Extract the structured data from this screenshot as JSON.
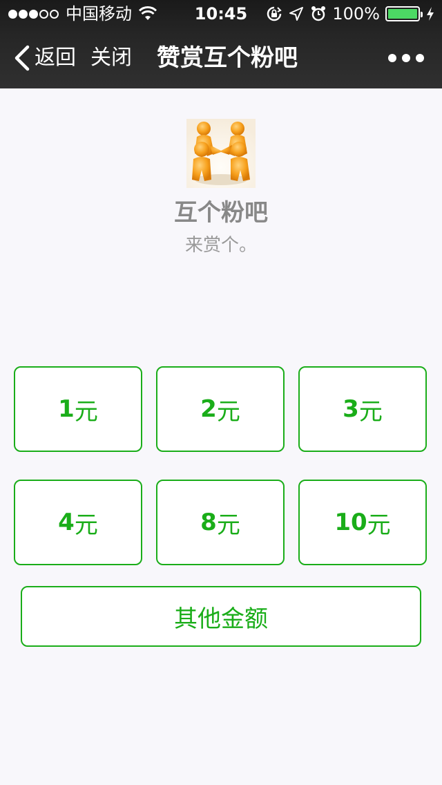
{
  "status_bar": {
    "carrier": "中国移动",
    "time": "10:45",
    "battery": "100%",
    "signal_bars_filled": 3,
    "signal_bars_total": 5,
    "icons": [
      "wifi-icon",
      "rotation-lock-icon",
      "location-icon",
      "alarm-icon",
      "battery-icon",
      "charging-icon"
    ]
  },
  "nav": {
    "back_label": "返回",
    "close_label": "关闭",
    "title": "赞赏互个粉吧",
    "more_icon": "more-dots-icon"
  },
  "profile": {
    "avatar_icon": "teamwork-figures-image",
    "name": "互个粉吧",
    "description": "来赏个。"
  },
  "amounts": [
    {
      "value": "1",
      "unit": "元"
    },
    {
      "value": "2",
      "unit": "元"
    },
    {
      "value": "3",
      "unit": "元"
    },
    {
      "value": "4",
      "unit": "元"
    },
    {
      "value": "8",
      "unit": "元"
    },
    {
      "value": "10",
      "unit": "元"
    }
  ],
  "other_amount_label": "其他金额",
  "colors": {
    "accent": "#1aad19",
    "navbar": "#262626",
    "battery": "#4cd964",
    "background": "#f8f7fb"
  }
}
